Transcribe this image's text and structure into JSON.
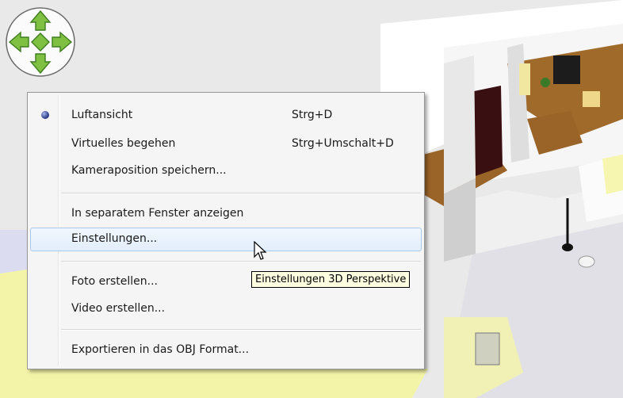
{
  "menu": {
    "items": [
      {
        "label": "Luftansicht",
        "shortcut": "Strg+D",
        "checked": true
      },
      {
        "label": "Virtuelles begehen",
        "shortcut": "Strg+Umschalt+D",
        "checked": false
      },
      {
        "label": "Kameraposition speichern...",
        "shortcut": "",
        "checked": false
      },
      {
        "label": "In separatem Fenster anzeigen",
        "shortcut": "",
        "checked": false
      },
      {
        "label": "Einstellungen...",
        "shortcut": "",
        "checked": false,
        "highlighted": true
      },
      {
        "label": "Foto erstellen...",
        "shortcut": "",
        "checked": false
      },
      {
        "label": "Video erstellen...",
        "shortcut": "",
        "checked": false
      },
      {
        "label": "Exportieren in das OBJ Format...",
        "shortcut": "",
        "checked": false
      }
    ]
  },
  "tooltip": {
    "text": "Einstellungen 3D Perspektive"
  },
  "navigator": {
    "icon": "navigation-arrows-icon"
  },
  "colors": {
    "highlight_border": "#a8c8ea",
    "tooltip_bg": "#ffffe1",
    "nav_green": "#7fc043"
  }
}
